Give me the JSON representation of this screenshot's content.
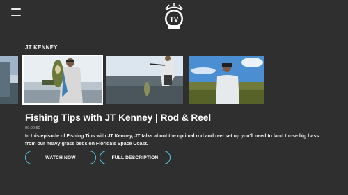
{
  "header": {
    "menu_icon": "hamburger-menu-icon",
    "logo_text": "TV",
    "logo_icon": "sportsman-tv-logo"
  },
  "row": {
    "title": "JT KENNEY",
    "thumbnails": [
      {
        "name": "partial-thumbnail",
        "selected": false
      },
      {
        "name": "angler-holding-bass",
        "selected": true
      },
      {
        "name": "angler-landing-fish",
        "selected": false
      },
      {
        "name": "angler-in-cap",
        "selected": false
      }
    ]
  },
  "episode": {
    "title": "Fishing Tips with JT Kenney | Rod & Reel",
    "duration": "00:00:50",
    "description": "In this episode of Fishing Tips with JT Kenney, JT talks about the optimal rod and reel set up you'll need to land those big bass from our heavy grass beds on Florida's Space Coast."
  },
  "actions": {
    "watch_label": "WATCH NOW",
    "description_label": "FULL DESCRIPTION",
    "accent_color": "#4fc6e0"
  }
}
